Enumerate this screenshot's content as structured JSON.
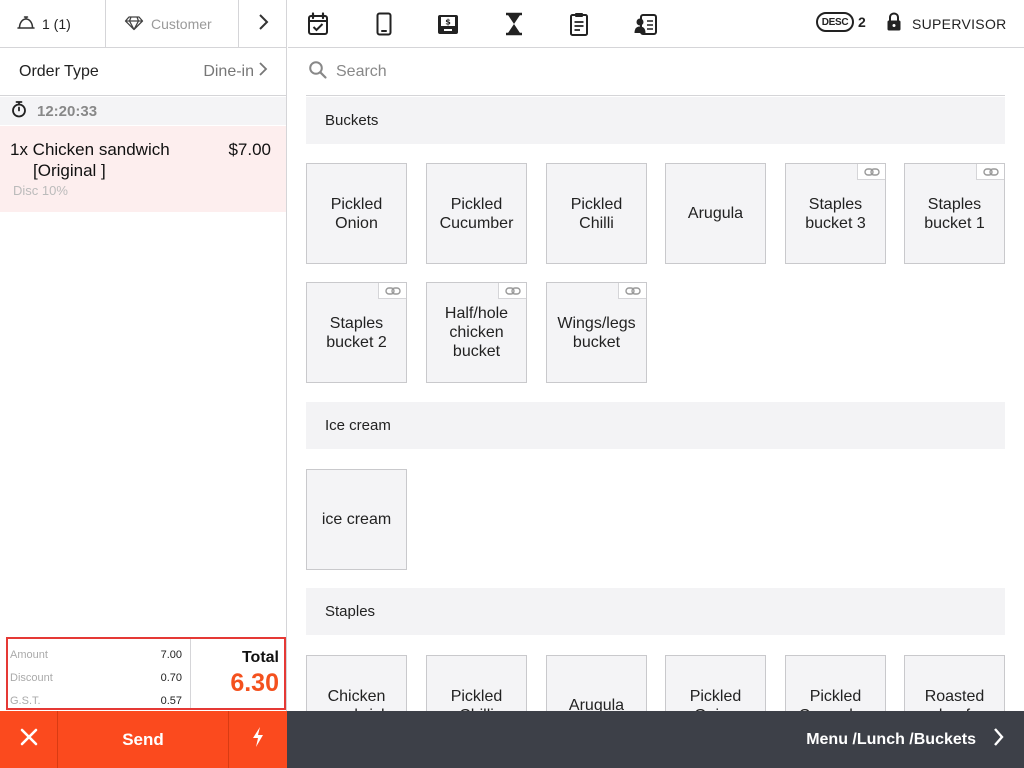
{
  "left_top": {
    "guests": "1 (1)",
    "customer": "Customer"
  },
  "order_type": {
    "label": "Order Type",
    "value": "Dine-in"
  },
  "timer": "12:20:33",
  "order_item": {
    "qty_name": "1x Chicken sandwich",
    "modifier": "[Original ]",
    "price": "$7.00",
    "discount": "Disc 10%"
  },
  "totals": {
    "lines": [
      {
        "label": "Amount",
        "value": "7.00"
      },
      {
        "label": "Discount",
        "value": "0.70"
      },
      {
        "label": "G.S.T.",
        "value": "0.57"
      }
    ],
    "total_label": "Total",
    "total_value": "6.30"
  },
  "actions": {
    "send": "Send"
  },
  "topbar": {
    "desc_badge": "DESC",
    "desc_count": "2",
    "role": "SUPERVISOR"
  },
  "search": {
    "placeholder": "Search"
  },
  "categories": [
    {
      "name": "Buckets",
      "items": [
        {
          "label": "Pickled\nOnion",
          "linked": false
        },
        {
          "label": "Pickled\nCucumber",
          "linked": false
        },
        {
          "label": "Pickled\nChilli",
          "linked": false
        },
        {
          "label": "Arugula",
          "linked": false
        },
        {
          "label": "Staples\nbucket  3",
          "linked": true
        },
        {
          "label": "Staples\nbucket  1",
          "linked": true
        },
        {
          "label": "Staples\nbucket  2",
          "linked": true
        },
        {
          "label": "Half/hole\nchicken\nbucket",
          "linked": true
        },
        {
          "label": "Wings/legs\nbucket",
          "linked": true
        }
      ]
    },
    {
      "name": "Ice cream",
      "items": [
        {
          "label": "ice  cream",
          "linked": false
        }
      ]
    },
    {
      "name": "Staples",
      "items": [
        {
          "label": "Chicken\nsandwich",
          "linked": false
        },
        {
          "label": "Pickled\nChilli",
          "linked": false
        },
        {
          "label": "Arugula",
          "linked": false
        },
        {
          "label": "Pickled\nOnion",
          "linked": false
        },
        {
          "label": "Pickled\nCucumber",
          "linked": false
        },
        {
          "label": "Roasted\nbeef",
          "linked": false
        }
      ]
    }
  ],
  "breadcrumb": "Menu /Lunch /Buckets",
  "colors": {
    "accent": "#fb4a1e",
    "total": "#f4511e",
    "footer": "#3d4048",
    "highlight_border": "#e53935",
    "item_bg": "#fdeeee"
  }
}
